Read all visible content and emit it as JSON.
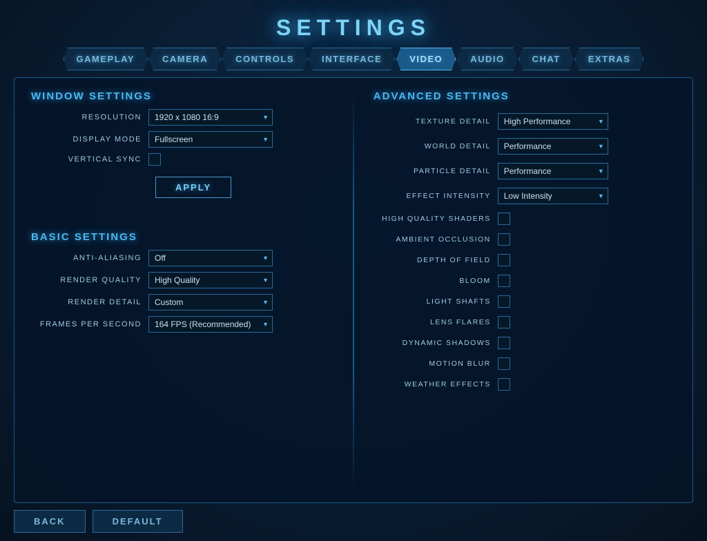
{
  "page": {
    "title": "SETTINGS"
  },
  "tabs": [
    {
      "id": "gameplay",
      "label": "GAMEPLAY",
      "active": false
    },
    {
      "id": "camera",
      "label": "CAMERA",
      "active": false
    },
    {
      "id": "controls",
      "label": "CONTROLS",
      "active": false
    },
    {
      "id": "interface",
      "label": "INTERFACE",
      "active": false
    },
    {
      "id": "video",
      "label": "VIDEO",
      "active": true
    },
    {
      "id": "audio",
      "label": "AUDIO",
      "active": false
    },
    {
      "id": "chat",
      "label": "CHAT",
      "active": false
    },
    {
      "id": "extras",
      "label": "EXTRAS",
      "active": false
    }
  ],
  "window_settings": {
    "title": "WINDOW SETTINGS",
    "resolution_label": "RESOLUTION",
    "resolution_value": "1920 x 1080 16:9",
    "display_mode_label": "DISPLAY MODE",
    "display_mode_value": "Fullscreen",
    "vertical_sync_label": "VERTICAL SYNC",
    "apply_label": "APPLY"
  },
  "basic_settings": {
    "title": "BASIC SETTINGS",
    "anti_aliasing_label": "ANTI-ALIASING",
    "anti_aliasing_value": "Off",
    "render_quality_label": "RENDER QUALITY",
    "render_quality_value": "High Quality",
    "render_detail_label": "RENDER DETAIL",
    "render_detail_value": "Custom",
    "fps_label": "FRAMES PER SECOND",
    "fps_value": "164  FPS (Recommended)"
  },
  "advanced_settings": {
    "title": "ADVANCED SETTINGS",
    "texture_detail_label": "TEXTURE DETAIL",
    "texture_detail_value": "High Performance",
    "world_detail_label": "WORLD DETAIL",
    "world_detail_value": "Performance",
    "particle_detail_label": "PARTICLE DETAIL",
    "particle_detail_value": "Performance",
    "effect_intensity_label": "EFFECT INTENSITY",
    "effect_intensity_value": "Low Intensity",
    "high_quality_shaders_label": "HIGH QUALITY SHADERS",
    "ambient_occlusion_label": "AMBIENT OCCLUSION",
    "depth_of_field_label": "DEPTH OF FIELD",
    "bloom_label": "BLOOM",
    "light_shafts_label": "LIGHT SHAFTS",
    "lens_flares_label": "LENS FLARES",
    "dynamic_shadows_label": "DYNAMIC SHADOWS",
    "motion_blur_label": "MOTION BLUR",
    "weather_effects_label": "WEATHER EFFECTS"
  },
  "bottom": {
    "back_label": "BACK",
    "default_label": "DEFAULT"
  }
}
